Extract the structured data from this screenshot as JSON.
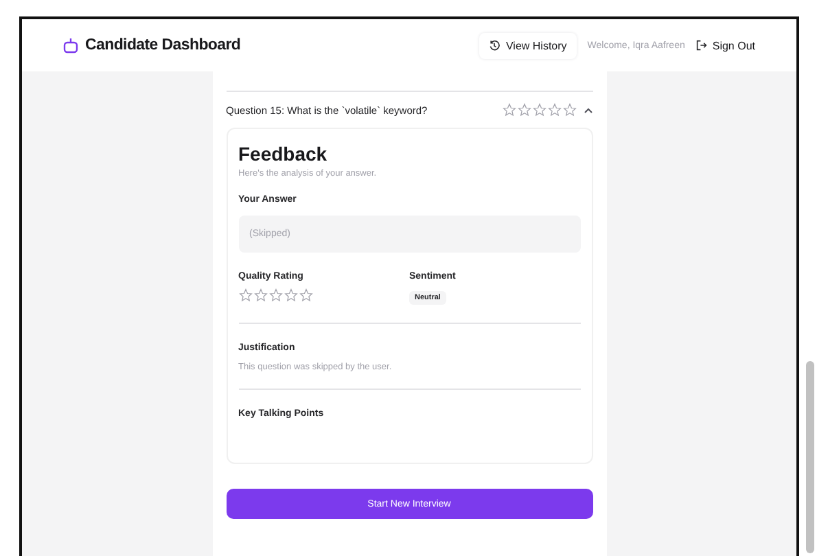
{
  "header": {
    "title": "Candidate Dashboard",
    "history_button": "View History",
    "welcome": "Welcome, Iqra Aafreen",
    "sign_out": "Sign Out"
  },
  "question": {
    "title": "Question 15: What is the `volatile` keyword?",
    "stars": 0,
    "expanded": true
  },
  "feedback": {
    "title": "Feedback",
    "subtitle": "Here's the analysis of your answer.",
    "answer_label": "Your Answer",
    "answer": "(Skipped)",
    "rating": {
      "label": "Quality Rating",
      "stars": 0
    },
    "sentiment_label": "Sentiment",
    "sentiment": "Neutral",
    "justification_label": "Justification",
    "justification": "This question was skipped by the user.",
    "talking_points_label": "Key Talking Points"
  },
  "start_button": "Start New Interview"
}
